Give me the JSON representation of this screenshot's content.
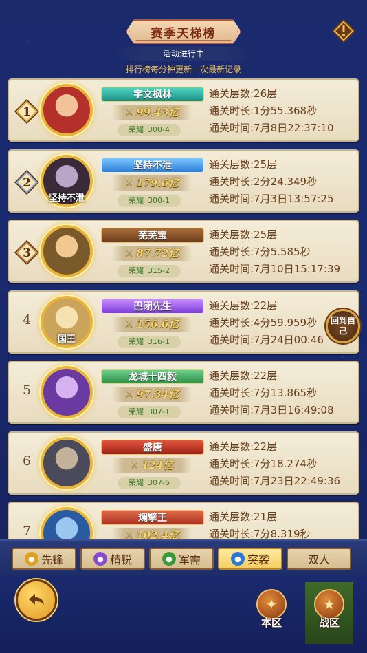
{
  "header": {
    "title": "赛季天梯榜",
    "status": "活动进行中",
    "update_note": "排行榜每分钟更新一次最新记录"
  },
  "colors": {
    "background": "#1b2a6b",
    "card": "#f3ecd8",
    "stats_text": "#6b3f1c",
    "power_gold": "#f3d36a",
    "honor_green": "#3c7a2a"
  },
  "rankings": [
    {
      "rank": "1",
      "name": "宇文枫林",
      "banner": "teal",
      "power": "99.43亿",
      "honor_label": "荣耀",
      "honor_value": "300-4",
      "avatar_tag": "",
      "floors": "通关层数:26层",
      "duration": "通关时长:1分55.368秒",
      "time": "通关时间:7月8日22:37:10"
    },
    {
      "rank": "2",
      "name": "坚持不泄",
      "banner": "blue",
      "power": "179.6亿",
      "honor_label": "荣耀",
      "honor_value": "300-1",
      "avatar_tag": "坚持不泄",
      "floors": "通关层数:25层",
      "duration": "通关时长:2分24.349秒",
      "time": "通关时间:7月3日13:57:25"
    },
    {
      "rank": "3",
      "name": "芜芜宝",
      "banner": "brown",
      "power": "87.72亿",
      "honor_label": "荣耀",
      "honor_value": "315-2",
      "avatar_tag": "",
      "floors": "通关层数:25层",
      "duration": "通关时长:7分5.585秒",
      "time": "通关时间:7月10日15:17:39"
    },
    {
      "rank": "4",
      "name": "巴闭先生",
      "banner": "purple",
      "power": "156.6亿",
      "honor_label": "荣耀",
      "honor_value": "316-1",
      "avatar_tag": "国王",
      "floors": "通关层数:22层",
      "duration": "通关时长:4分59.959秒",
      "time": "通关时间:7月24日00:46"
    },
    {
      "rank": "5",
      "name": "龙城十四毅",
      "banner": "green",
      "power": "97.34亿",
      "honor_label": "荣耀",
      "honor_value": "307-1",
      "avatar_tag": "",
      "floors": "通关层数:22层",
      "duration": "通关时长:7分13.865秒",
      "time": "通关时间:7月3日16:49:08"
    },
    {
      "rank": "6",
      "name": "盛唐",
      "banner": "red",
      "power": "124亿",
      "honor_label": "荣耀",
      "honor_value": "307-6",
      "avatar_tag": "",
      "floors": "通关层数:22层",
      "duration": "通关时长:7分18.274秒",
      "time": "通关时间:7月23日22:49:36"
    },
    {
      "rank": "7",
      "name": "斓擘王",
      "banner": "red2",
      "power": "102.4亿",
      "honor_label": "荣耀",
      "honor_value": "",
      "avatar_tag": "",
      "floors": "通关层数:21层",
      "duration": "通关时长:7分8.319秒",
      "time": ""
    }
  ],
  "back_to_self": "回到自己",
  "tabs": [
    {
      "label": "先锋",
      "icon": "shield-icon",
      "color": "#e0a020"
    },
    {
      "label": "精锐",
      "icon": "purple-emblem-icon",
      "color": "#8a4ad0"
    },
    {
      "label": "军需",
      "icon": "leaf-icon",
      "color": "#3a9a3a"
    },
    {
      "label": "突袭",
      "icon": "swirl-icon",
      "color": "#2a78d0"
    },
    {
      "label": "双人",
      "icon": "",
      "color": ""
    }
  ],
  "active_tab": "突袭",
  "nav": {
    "local_label": "本区",
    "battle_label": "战区"
  }
}
